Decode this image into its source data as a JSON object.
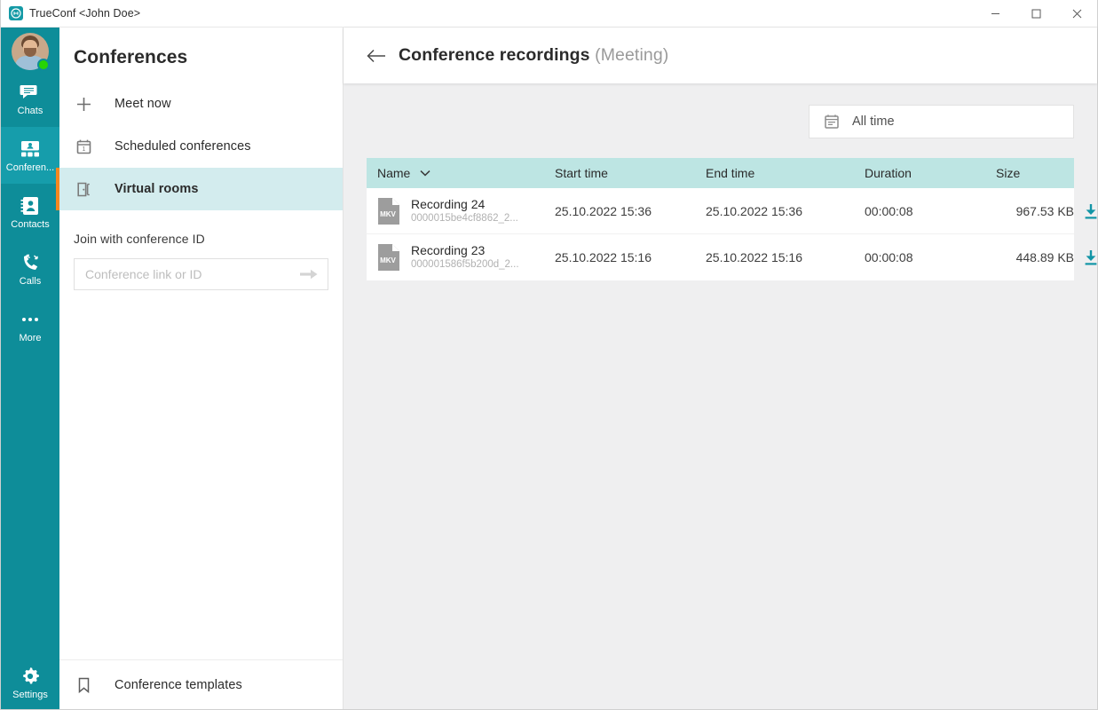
{
  "window": {
    "app_title": "TrueConf",
    "user": "<John Doe>",
    "logo_icon": "trueconf-logo-icon",
    "controls": {
      "minimize": "minimize-icon",
      "maximize": "maximize-icon",
      "close": "close-icon"
    }
  },
  "rail": {
    "avatar": {
      "name": "avatar",
      "status": "online"
    },
    "items": [
      {
        "label": "Chats",
        "icon": "chat-icon",
        "active": false
      },
      {
        "label": "Conferen...",
        "icon": "conference-icon",
        "active": true
      },
      {
        "label": "Contacts",
        "icon": "contacts-icon",
        "active": false
      },
      {
        "label": "Calls",
        "icon": "calls-icon",
        "active": false
      },
      {
        "label": "More",
        "icon": "more-dots-icon",
        "active": false
      }
    ],
    "settings": {
      "label": "Settings",
      "icon": "gear-icon"
    }
  },
  "sidebar": {
    "title": "Conferences",
    "items": [
      {
        "label": "Meet now",
        "icon": "plus-icon",
        "active": false
      },
      {
        "label": "Scheduled conferences",
        "icon": "calendar-icon",
        "active": false
      },
      {
        "label": "Virtual rooms",
        "icon": "door-icon",
        "active": true
      }
    ],
    "join": {
      "label": "Join with conference ID",
      "placeholder": "Conference link or ID",
      "value": "",
      "submit_icon": "arrow-right-icon"
    },
    "bottom": {
      "label": "Conference templates",
      "icon": "bookmark-icon"
    }
  },
  "main": {
    "back_icon": "arrow-left-icon",
    "title": "Conference recordings",
    "subtitle": "(Meeting)",
    "filter": {
      "label": "All time",
      "icon": "calendar-icon"
    },
    "table": {
      "columns": [
        "Name",
        "Start time",
        "End time",
        "Duration",
        "Size"
      ],
      "sort_icon": "chevron-down-icon",
      "download_icon": "download-icon",
      "rows": [
        {
          "file_type": "MKV",
          "name": "Recording 24",
          "file_id": "0000015be4cf8862_2...",
          "start_time": "25.10.2022 15:36",
          "end_time": "25.10.2022 15:36",
          "duration": "00:00:08",
          "size": "967.53 KB"
        },
        {
          "file_type": "MKV",
          "name": "Recording 23",
          "file_id": "000001586f5b200d_2...",
          "start_time": "25.10.2022 15:16",
          "end_time": "25.10.2022 15:16",
          "duration": "00:00:08",
          "size": "448.89 KB"
        }
      ]
    }
  },
  "colors": {
    "rail": "#0e8d99",
    "rail_active": "#169dab",
    "accent_orange": "#f6871f",
    "table_header": "#bde5e3",
    "sidebar_active": "#d3ecee",
    "download_teal": "#0e8d99",
    "status_green": "#27d406"
  }
}
